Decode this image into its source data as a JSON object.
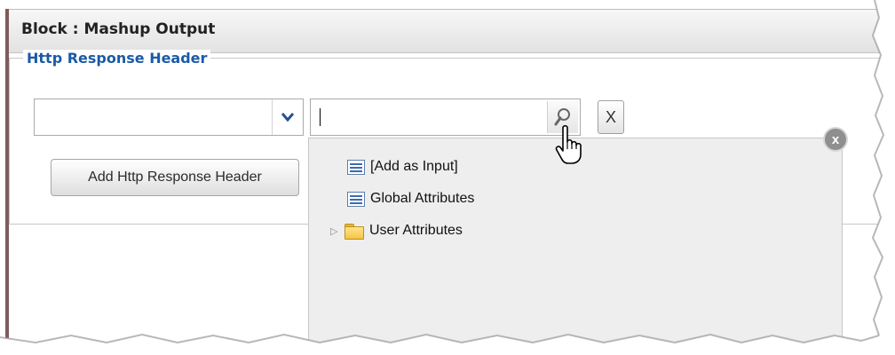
{
  "panel": {
    "title": "Block : Mashup Output"
  },
  "section": {
    "legend": "Http Response Header"
  },
  "header_select": {
    "value": ""
  },
  "search": {
    "value": "",
    "placeholder": ""
  },
  "buttons": {
    "clear_label": "X",
    "add_label": "Add Http Response Header"
  },
  "dropdown": {
    "items": [
      {
        "label": "[Add as Input]",
        "icon": "attribute-icon",
        "expandable": false
      },
      {
        "label": "Global Attributes",
        "icon": "attribute-icon",
        "expandable": false
      },
      {
        "label": "User Attributes",
        "icon": "folder-icon",
        "expandable": true
      }
    ],
    "close_label": "x"
  },
  "colors": {
    "legend": "#1b5aa8",
    "dropdown_bg": "#eeeeee",
    "left_rail": "#7d5c5c"
  }
}
